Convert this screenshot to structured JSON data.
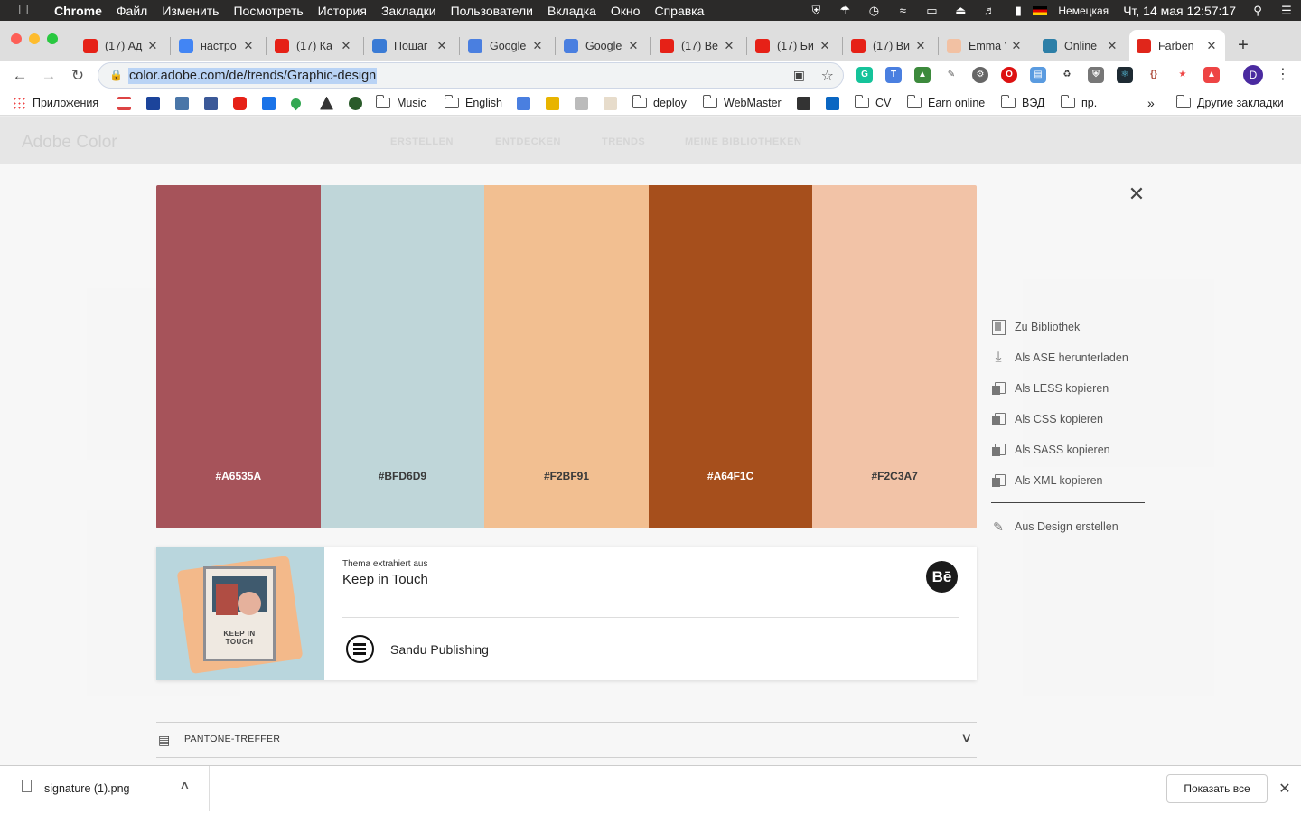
{
  "menubar": {
    "apple": "",
    "app": "Chrome",
    "items": [
      "Файл",
      "Изменить",
      "Посмотреть",
      "История",
      "Закладки",
      "Пользователи",
      "Вкладка",
      "Окно",
      "Справка"
    ],
    "keyboard": "Немецкая",
    "clock": "Чт, 14 мая  12:57:17"
  },
  "tabs": [
    {
      "label": "(17) Ад",
      "favicon": "youtube-icon",
      "color": "#e62117"
    },
    {
      "label": "настро",
      "favicon": "google-icon",
      "color": "#4285f4"
    },
    {
      "label": "(17) Ка",
      "favicon": "youtube-icon",
      "color": "#e62117"
    },
    {
      "label": "Пошаг",
      "favicon": "puzzle-icon",
      "color": "#3a7bd5"
    },
    {
      "label": "Google",
      "favicon": "translate-icon",
      "color": "#4a7fe0"
    },
    {
      "label": "Google",
      "favicon": "translate-icon",
      "color": "#4a7fe0"
    },
    {
      "label": "(17) Be",
      "favicon": "youtube-icon",
      "color": "#e62117"
    },
    {
      "label": "(17) Би",
      "favicon": "youtube-icon",
      "color": "#e62117"
    },
    {
      "label": "(17) Ви",
      "favicon": "youtube-icon",
      "color": "#e62117"
    },
    {
      "label": "Emma V",
      "favicon": "emma-icon",
      "color": "#f2c1a3"
    },
    {
      "label": "Online",
      "favicon": "d-icon",
      "color": "#2d7fa7"
    },
    {
      "label": "Farben",
      "favicon": "adobe-icon",
      "color": "#e0261b",
      "active": true
    }
  ],
  "toolbar": {
    "url": "color.adobe.com/de/trends/Graphic-design",
    "profile_initial": "D"
  },
  "bookmarks": {
    "apps": "Приложения",
    "items": [
      "Music",
      "English",
      "deploy",
      "WebMaster",
      "CV",
      "Earn online",
      "ВЭД",
      "пр."
    ],
    "more": "»",
    "other": "Другие закладки"
  },
  "page": {
    "brand": "Adobe Color",
    "nav": [
      "ERSTELLEN",
      "ENTDECKEN",
      "TRENDS",
      "MEINE BIBLIOTHEKEN"
    ]
  },
  "palette": {
    "swatches": [
      {
        "hex": "#A6535A",
        "color": "#A6535A",
        "text_color": "#ffffff"
      },
      {
        "hex": "#BFD6D9",
        "color": "#BFD6D9",
        "text_color": "#3a3a3a"
      },
      {
        "hex": "#F2BF91",
        "color": "#F2BF91",
        "text_color": "#3a3a3a"
      },
      {
        "hex": "#A64F1C",
        "color": "#A64F1C",
        "text_color": "#ffffff"
      },
      {
        "hex": "#F2C3A7",
        "color": "#F2C3A7",
        "text_color": "#3a3a3a"
      }
    ]
  },
  "actions": {
    "library": "Zu Bibliothek",
    "ase": "Als ASE herunterladen",
    "less": "Als LESS kopieren",
    "css": "Als CSS kopieren",
    "sass": "Als SASS kopieren",
    "xml": "Als XML kopieren",
    "design": "Aus Design erstellen"
  },
  "card": {
    "subtitle": "Thema extrahiert aus",
    "title": "Keep in Touch",
    "behance": "Bē",
    "publisher": "Sandu Publishing",
    "thumb_text": "KEEP IN TOUCH"
  },
  "pantone": {
    "label": "PANTONE-TREFFER"
  },
  "downloads": {
    "file": "signature (1).png",
    "show_all": "Показать все"
  }
}
